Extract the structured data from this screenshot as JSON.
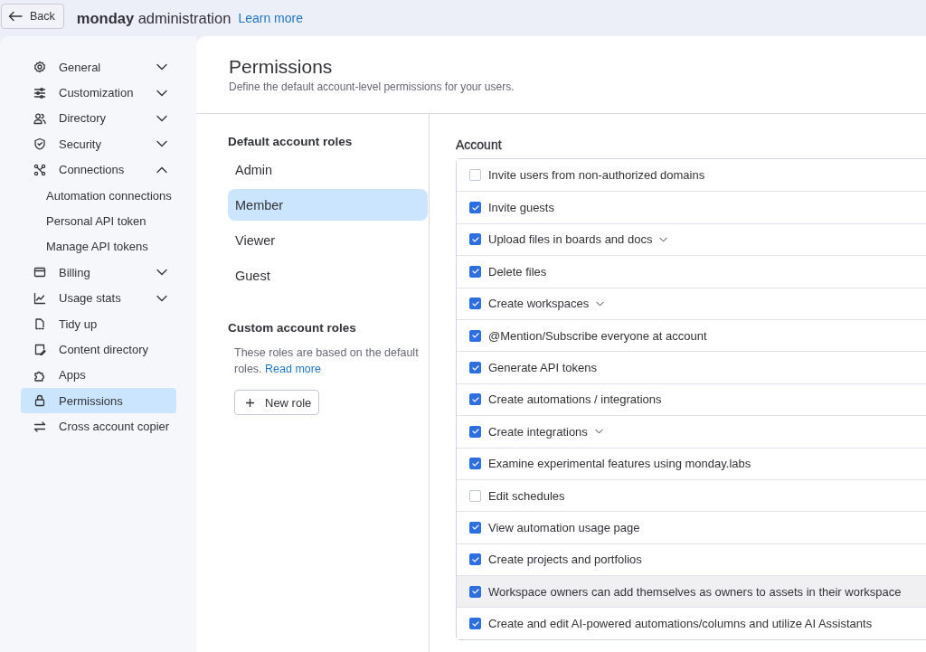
{
  "top_bar": {
    "back_button": "Back",
    "title": "**monday** administration",
    "learn_more_link": "Learn more"
  },
  "sidebar": {
    "items": [
      {
        "label": "General",
        "kind": "group",
        "expanded": false,
        "selected": false
      },
      {
        "label": "Customization",
        "kind": "group",
        "expanded": false,
        "selected": false
      },
      {
        "label": "Directory",
        "kind": "group",
        "expanded": false,
        "selected": false
      },
      {
        "label": "Security",
        "kind": "group",
        "expanded": false,
        "selected": false
      },
      {
        "label": "Connections",
        "kind": "group",
        "expanded": true,
        "selected": false
      },
      {
        "label": "Automation connections",
        "kind": "sub",
        "selected": false
      },
      {
        "label": "Personal API token",
        "kind": "sub",
        "selected": false
      },
      {
        "label": "Manage API tokens",
        "kind": "sub",
        "selected": false
      },
      {
        "label": "Billing",
        "kind": "group",
        "expanded": false,
        "selected": false
      },
      {
        "label": "Usage stats",
        "kind": "group",
        "expanded": false,
        "selected": false
      },
      {
        "label": "Tidy up",
        "kind": "page",
        "selected": false
      },
      {
        "label": "Content directory",
        "kind": "page",
        "selected": false
      },
      {
        "label": "Apps",
        "kind": "page",
        "selected": false
      },
      {
        "label": "Permissions",
        "kind": "page",
        "selected": true
      },
      {
        "label": "Cross account copier",
        "kind": "page",
        "selected": false
      }
    ]
  },
  "header": {
    "title": "Permissions",
    "subtitle": "Define the default account-level permissions for your users."
  },
  "roles": {
    "default_heading": "Default account roles",
    "default_roles": [
      {
        "label": "Admin",
        "selected": false
      },
      {
        "label": "Member",
        "selected": true
      },
      {
        "label": "Viewer",
        "selected": false
      },
      {
        "label": "Guest",
        "selected": false
      }
    ],
    "custom_heading": "Custom account roles",
    "custom_description": "These roles are based on the default roles.",
    "read_more_link": "Read more",
    "new_role_button": "New role"
  },
  "account": {
    "heading": "Account",
    "permissions": [
      {
        "label": "Invite users from non-authorized domains",
        "checked": false,
        "has_options": false,
        "highlighted": false
      },
      {
        "label": "Invite guests",
        "checked": true,
        "has_options": false,
        "highlighted": false
      },
      {
        "label": "Upload files in boards and docs",
        "checked": true,
        "has_options": true,
        "highlighted": false
      },
      {
        "label": "Delete files",
        "checked": true,
        "has_options": false,
        "highlighted": false
      },
      {
        "label": "Create workspaces",
        "checked": true,
        "has_options": true,
        "highlighted": false
      },
      {
        "label": "@Mention/Subscribe everyone at account",
        "checked": true,
        "has_options": false,
        "highlighted": false
      },
      {
        "label": "Generate API tokens",
        "checked": true,
        "has_options": false,
        "highlighted": false
      },
      {
        "label": "Create automations / integrations",
        "checked": true,
        "has_options": false,
        "highlighted": false
      },
      {
        "label": "Create integrations",
        "checked": true,
        "has_options": true,
        "highlighted": false
      },
      {
        "label": "Examine experimental features using monday.labs",
        "checked": true,
        "has_options": false,
        "highlighted": false
      },
      {
        "label": "Edit schedules",
        "checked": false,
        "has_options": false,
        "highlighted": false
      },
      {
        "label": "View automation usage page",
        "checked": true,
        "has_options": false,
        "highlighted": false
      },
      {
        "label": "Create projects and portfolios",
        "checked": true,
        "has_options": false,
        "highlighted": false
      },
      {
        "label": "Workspace owners can add themselves as owners to assets in their workspace",
        "checked": true,
        "has_options": false,
        "highlighted": true
      },
      {
        "label": "Create and edit AI-powered automations/columns and utilize AI Assistants",
        "checked": true,
        "has_options": false,
        "highlighted": false
      }
    ]
  }
}
